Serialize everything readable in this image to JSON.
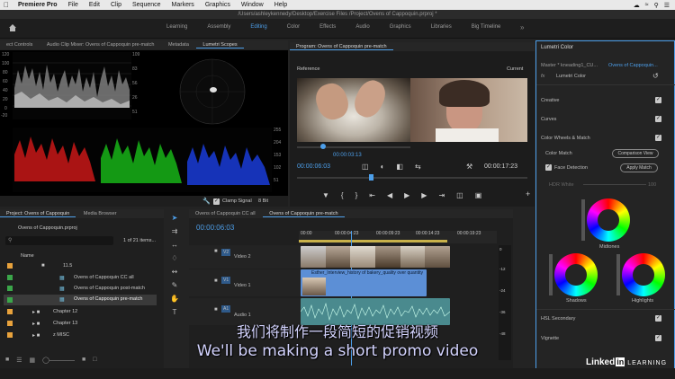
{
  "menubar": {
    "app": "Premiere Pro",
    "items": [
      "File",
      "Edit",
      "Clip",
      "Sequence",
      "Markers",
      "Graphics",
      "Window",
      "Help"
    ]
  },
  "titlebar": {
    "path": "/Users/ashleykennedy/Desktop/Exercise Files /Project/Ovens of Cappoquin.prproj *"
  },
  "workspaces": {
    "items": [
      "Learning",
      "Assembly",
      "Editing",
      "Color",
      "Effects",
      "Audio",
      "Graphics",
      "Libraries",
      "Big Timeline"
    ],
    "active": "Editing"
  },
  "scopes_panel": {
    "tabs": [
      "ect Controls",
      "Audio Clip Mixer: Ovens of Cappoquin pre-match",
      "Metadata",
      "Lumetri Scopes"
    ],
    "active": "Lumetri Scopes",
    "left_ticks": [
      "120",
      "100",
      "80",
      "60",
      "40",
      "20",
      "0",
      "-20"
    ],
    "right_ticks": [
      "255",
      "204",
      "153",
      "102",
      "51"
    ],
    "right_ticks_top": [
      "109",
      "83",
      "56",
      "26",
      "51"
    ],
    "clamp_signal": "Clamp Signal",
    "bit_depth": "8 Bit"
  },
  "program_monitor": {
    "title": "Program: Ovens of Cappoquin pre-match",
    "reference_label": "Reference",
    "current_label": "Current",
    "ref_timecode": "00:00:03:13",
    "timecode_left": "00:00:06:03",
    "timecode_right": "00:00:17:23"
  },
  "lumetri_color": {
    "title": "Lumetri Color",
    "master_label": "Master * kneading1_CU...",
    "sequence_label": "Ovens of Cappoquin...",
    "fx_label": "Lumetri Color",
    "sections": [
      "Creative",
      "Curves",
      "Color Wheels & Match"
    ],
    "color_match": "Color Match",
    "comparison_view": "Comparison View",
    "face_detection": "Face Detection",
    "apply_match": "Apply Match",
    "hdr_white": "HDR White",
    "hdr_value": "100",
    "midtones": "Midtones",
    "shadows": "Shadows",
    "highlights": "Highlights",
    "hsl_secondary": "HSL Secondary",
    "vignette": "Vignette"
  },
  "project_panel": {
    "tabs": [
      "Project: Ovens of Cappoquin",
      "Media Browser"
    ],
    "file": "Ovens of Cappoquin.prproj",
    "count": "1 of 21 items...",
    "name_header": "Name",
    "items": [
      {
        "label": "11.5",
        "type": "folder"
      },
      {
        "label": "Ovens of Cappoquin CC all",
        "type": "sequence"
      },
      {
        "label": "Ovens of Cappoquin post-match",
        "type": "sequence"
      },
      {
        "label": "Ovens of Cappoquin pre-match",
        "type": "sequence"
      },
      {
        "label": "Chapter 12",
        "type": "folder"
      },
      {
        "label": "Chapter 13",
        "type": "folder"
      },
      {
        "label": "z MISC",
        "type": "folder"
      }
    ]
  },
  "timeline": {
    "tabs": [
      "Ovens of Cappoquin CC all",
      "Ovens of Cappoquin pre-match"
    ],
    "active": "Ovens of Cappoquin pre-match",
    "timecode": "00:00:06:03",
    "ruler": [
      "00:00",
      "00:00:04:23",
      "00:00:09:23",
      "00:00:14:23",
      "00:00:19:23"
    ],
    "tracks": {
      "v2": "Video 2",
      "v1": "Video 1",
      "a1": "Audio 1"
    },
    "clip_label": "Esther_Interview_history of bakery_quality over quantity",
    "meters": [
      "0",
      "-12",
      "-24",
      "-36",
      "-48"
    ]
  },
  "subtitles": {
    "cn": "我们将制作一段简短的促销视频",
    "en": "We'll be making a short promo video"
  },
  "logo": {
    "brand": "Linked",
    "in": "in",
    "learning": "LEARNING"
  }
}
